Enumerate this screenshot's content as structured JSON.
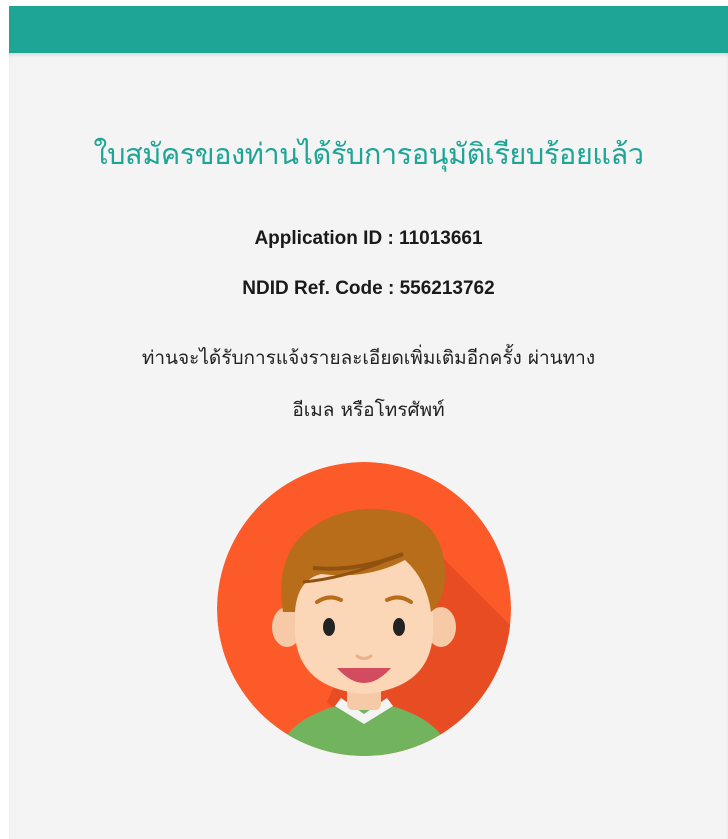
{
  "header": {
    "accent_color": "#1fa596"
  },
  "main": {
    "title": "ใบสมัครของท่านได้รับการอนุมัติเรียบร้อยแล้ว",
    "application_id": "Application ID : 11013661",
    "ndid_ref_code": "NDID Ref. Code : 556213762",
    "message_line1": "ท่านจะได้รับการแจ้งรายละเอียดเพิ่มเติมอีกครั้ง ผ่านทาง",
    "message_line2": "อีเมล หรือโทรศัพท์"
  },
  "avatar": {
    "icon": "smiling-boy-avatar-icon",
    "background_color": "#fd5a2a"
  }
}
